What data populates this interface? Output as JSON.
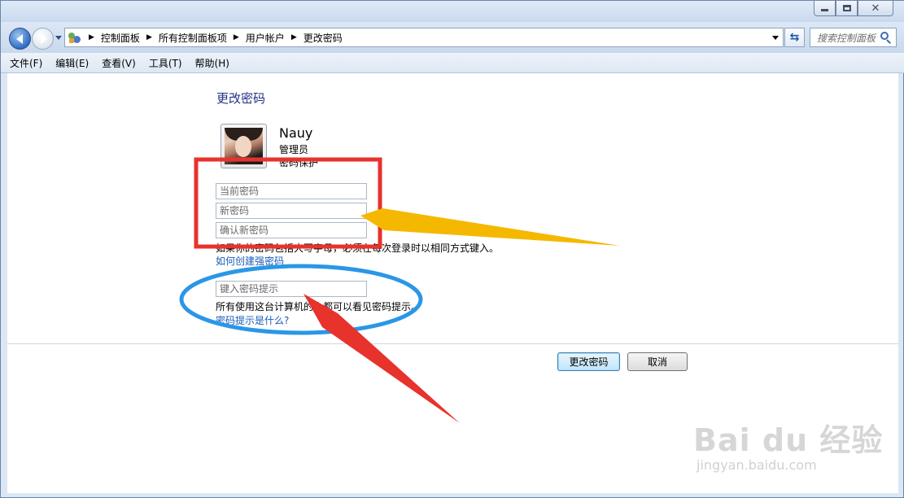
{
  "window": {
    "controls": {
      "minimize": "minimize",
      "maximize": "maximize",
      "close": "close"
    }
  },
  "address": {
    "breadcrumbs": [
      "控制面板",
      "所有控制面板项",
      "用户帐户",
      "更改密码"
    ],
    "search_placeholder": "搜索控制面板"
  },
  "menu": {
    "items": [
      "文件(F)",
      "编辑(E)",
      "查看(V)",
      "工具(T)",
      "帮助(H)"
    ]
  },
  "main": {
    "title": "更改密码",
    "user": {
      "name": "Nauy",
      "role": "管理员",
      "status": "密码保护"
    },
    "fields": {
      "current_password": "当前密码",
      "new_password": "新密码",
      "confirm_password": "确认新密码",
      "password_hint": "键入密码提示"
    },
    "caps_note": "如果你的密码包括大写字母，必须在每次登录时以相同方式键入。",
    "strong_password_link": "如何创建强密码",
    "hint_note": "所有使用这台计算机的人都可以看见密码提示。",
    "hint_link": "密码提示是什么?",
    "buttons": {
      "change": "更改密码",
      "cancel": "取消"
    }
  },
  "annotations": {
    "rect_color": "#e8322c",
    "ellipse_color": "#2a97e6",
    "yellow_arrow_color": "#f5b800",
    "red_arrow_color": "#e8322c"
  },
  "watermark": {
    "logo": "Bai du 经验",
    "url": "jingyan.baidu.com"
  }
}
